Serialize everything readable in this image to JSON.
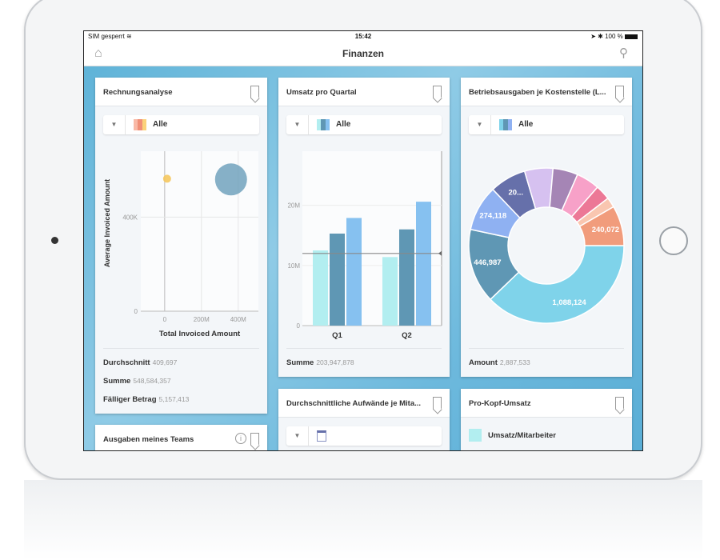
{
  "status_bar": {
    "carrier": "SIM gesperrt",
    "wifi_icon": "wifi-icon",
    "time": "15:42",
    "right": "➤ ✱ 100 %",
    "battery_icon": "battery-icon"
  },
  "nav": {
    "title": "Finanzen",
    "home_icon": "home-icon",
    "search_icon": "search-icon"
  },
  "cards": [
    {
      "title": "Rechnungsanalyse",
      "filter": "Alle",
      "filter_colors": [
        "#f9b9a6",
        "#f08f77",
        "#fbd27a"
      ],
      "summary": [
        {
          "label": "Durchschnitt",
          "value": "409,697"
        },
        {
          "label": "Summe",
          "value": "548,584,357"
        },
        {
          "label": "Fälliger Betrag",
          "value": "5,157,413"
        }
      ]
    },
    {
      "title": "Umsatz pro Quartal",
      "filter": "Alle",
      "filter_colors": [
        "#b2eef0",
        "#5f97b4",
        "#86c1f0"
      ],
      "summary": [
        {
          "label": "Summe",
          "value": "203,947,878"
        }
      ]
    },
    {
      "title": "Betriebsausgaben je Kostenstelle (L...",
      "filter": "Alle",
      "filter_colors": [
        "#7fd3ea",
        "#5f97b4",
        "#8fb1f2"
      ],
      "summary": [
        {
          "label": "Amount",
          "value": "2,887,533"
        }
      ]
    },
    {
      "title": "Ausgaben meines Teams",
      "info_icon": "info-icon"
    },
    {
      "title": "Durchschnittliche Aufwände je Mita..."
    },
    {
      "title": "Pro-Kopf-Umsatz",
      "legend": "Umsatz/Mitarbeiter",
      "legend_color": "#b2eef0"
    }
  ],
  "chart_data": [
    {
      "type": "scatter",
      "xlabel": "Total Invoiced Amount",
      "ylabel": "Average Invoiced Amount",
      "x_ticks": [
        "0",
        "200M",
        "400M"
      ],
      "y_ticks": [
        "0",
        "400K"
      ],
      "xlim": [
        -130,
        510
      ],
      "ylim": [
        0,
        680
      ],
      "x_unit": "M",
      "y_unit": "K",
      "points": [
        {
          "x": 13,
          "y": 563,
          "size": "small",
          "color": "#f5c85f"
        },
        {
          "x": 361,
          "y": 560,
          "size": "large",
          "color": "#5f97b4"
        }
      ]
    },
    {
      "type": "bar",
      "categories": [
        "Q1",
        "Q2"
      ],
      "y_ticks": [
        "0",
        "10M",
        "20M"
      ],
      "ylim": [
        0,
        29
      ],
      "y_unit": "M",
      "reference_line": 12,
      "series": [
        {
          "color": "#b2eef0",
          "values": [
            12.5,
            11.4
          ]
        },
        {
          "color": "#5f97b4",
          "values": [
            15.3,
            16.0
          ]
        },
        {
          "color": "#86c1f0",
          "values": [
            17.9,
            20.6
          ]
        }
      ]
    },
    {
      "type": "pie",
      "donut": true,
      "slices": [
        {
          "value": 1088124,
          "label": "1,088,124",
          "color": "#7fd3ea"
        },
        {
          "value": 446987,
          "label": "446,987",
          "color": "#5f97b4"
        },
        {
          "value": 274118,
          "label": "274,118",
          "color": "#8fb1f2"
        },
        {
          "value": 218000,
          "label": "20...",
          "color": "#6670aa"
        },
        {
          "value": 170000,
          "label": "",
          "color": "#d6c1f0"
        },
        {
          "value": 150000,
          "label": "",
          "color": "#a585b5"
        },
        {
          "value": 140000,
          "label": "",
          "color": "#f7a1c8"
        },
        {
          "value": 90000,
          "label": "",
          "color": "#ec7896"
        },
        {
          "value": 60000,
          "label": "",
          "color": "#f9c6b0"
        },
        {
          "value": 240072,
          "label": "240,072",
          "color": "#f19c7c"
        }
      ]
    }
  ]
}
